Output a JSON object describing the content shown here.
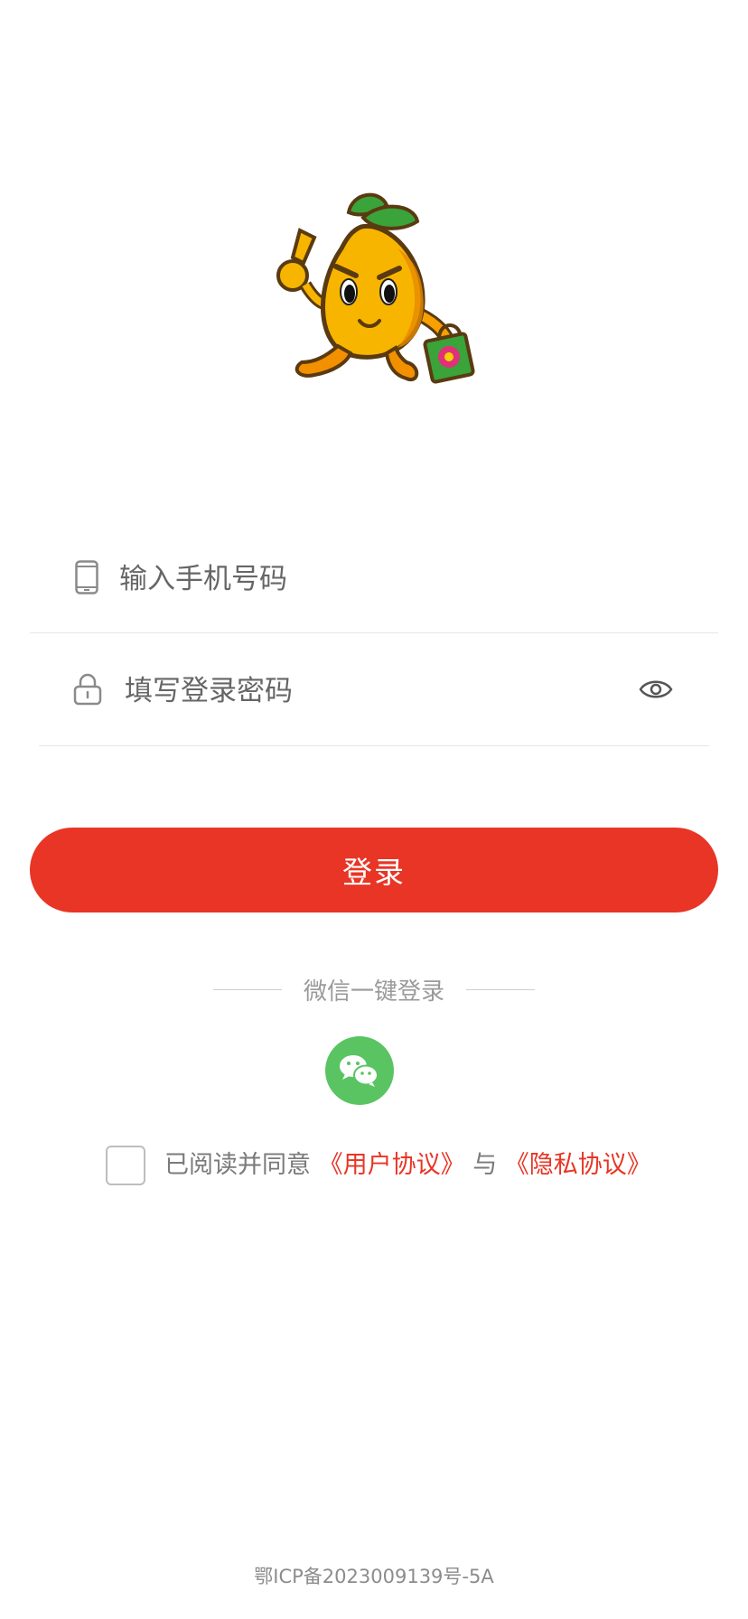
{
  "login_form": {
    "phone_placeholder": "输入手机号码",
    "password_placeholder": "填写登录密码",
    "login_button": "登录"
  },
  "wechat": {
    "title": "微信一键登录"
  },
  "agreement": {
    "prefix": "已阅读并同意",
    "user_agreement": "《用户协议》",
    "connector": "与",
    "privacy_agreement": "《隐私协议》"
  },
  "footer": {
    "icp": "鄂ICP备2023009139号-5A"
  },
  "icons": {
    "phone": "phone-icon",
    "lock": "lock-icon",
    "eye": "eye-icon",
    "wechat": "wechat-icon",
    "mascot": "mascot-logo"
  },
  "colors": {
    "accent": "#e83525",
    "wechat_green": "#5ac463"
  }
}
